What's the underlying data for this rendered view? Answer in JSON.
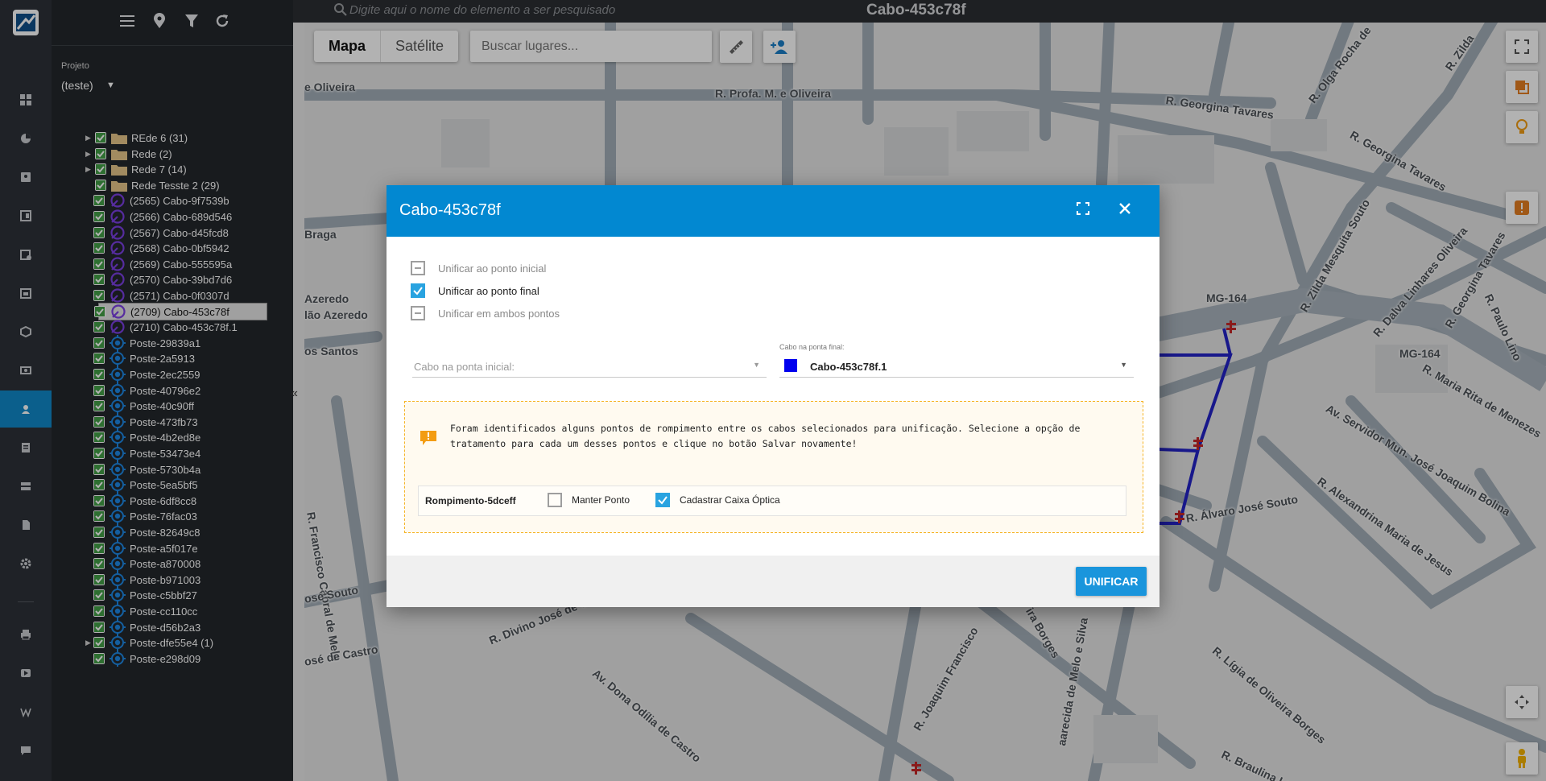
{
  "topbar": {
    "search_placeholder": "Digite aqui o nome do elemento a ser pesquisado",
    "title": "Cabo-453c78f"
  },
  "sidebar": {
    "project_label": "Projeto",
    "project_value": "(teste)",
    "tree_items": [
      {
        "label": "REde 6 (31)",
        "type": "folder",
        "expandable": true,
        "indent": 0
      },
      {
        "label": "Rede (2)",
        "type": "folder",
        "expandable": true,
        "indent": 0
      },
      {
        "label": "Rede 7 (14)",
        "type": "folder",
        "expandable": true,
        "indent": 0
      },
      {
        "label": "Rede Tesste 2 (29)",
        "type": "folder",
        "expandable": false,
        "indent": 0
      },
      {
        "label": "(2565) Cabo-9f7539b",
        "type": "cable",
        "indent": 1
      },
      {
        "label": "(2566) Cabo-689d546",
        "type": "cable",
        "indent": 1
      },
      {
        "label": "(2567) Cabo-d45fcd8",
        "type": "cable",
        "indent": 1
      },
      {
        "label": "(2568) Cabo-0bf5942",
        "type": "cable",
        "indent": 1
      },
      {
        "label": "(2569) Cabo-555595a",
        "type": "cable",
        "indent": 1
      },
      {
        "label": "(2570) Cabo-39bd7d6",
        "type": "cable",
        "indent": 1
      },
      {
        "label": "(2571) Cabo-0f0307d",
        "type": "cable",
        "indent": 1
      },
      {
        "label": "(2709) Cabo-453c78f",
        "type": "cable",
        "indent": 1,
        "selected": true
      },
      {
        "label": "(2710) Cabo-453c78f.1",
        "type": "cable",
        "indent": 1
      },
      {
        "label": "Poste-29839a1",
        "type": "pole",
        "indent": 1
      },
      {
        "label": "Poste-2a5913",
        "type": "pole",
        "indent": 1
      },
      {
        "label": "Poste-2ec2559",
        "type": "pole",
        "indent": 1
      },
      {
        "label": "Poste-40796e2",
        "type": "pole",
        "indent": 1
      },
      {
        "label": "Poste-40c90ff",
        "type": "pole",
        "indent": 1
      },
      {
        "label": "Poste-473fb73",
        "type": "pole",
        "indent": 1
      },
      {
        "label": "Poste-4b2ed8e",
        "type": "pole",
        "indent": 1
      },
      {
        "label": "Poste-53473e4",
        "type": "pole",
        "indent": 1
      },
      {
        "label": "Poste-5730b4a",
        "type": "pole",
        "indent": 1
      },
      {
        "label": "Poste-5ea5bf5",
        "type": "pole",
        "indent": 1
      },
      {
        "label": "Poste-6df8cc8",
        "type": "pole",
        "indent": 1
      },
      {
        "label": "Poste-76fac03",
        "type": "pole",
        "indent": 1
      },
      {
        "label": "Poste-82649c8",
        "type": "pole",
        "indent": 1
      },
      {
        "label": "Poste-a5f017e",
        "type": "pole",
        "indent": 1
      },
      {
        "label": "Poste-a870008",
        "type": "pole",
        "indent": 1
      },
      {
        "label": "Poste-b971003",
        "type": "pole",
        "indent": 1
      },
      {
        "label": "Poste-c5bbf27",
        "type": "pole",
        "indent": 1
      },
      {
        "label": "Poste-cc110cc",
        "type": "pole",
        "indent": 1
      },
      {
        "label": "Poste-d56b2a3",
        "type": "pole",
        "indent": 1
      },
      {
        "label": "Poste-dfe55e4 (1)",
        "type": "pole",
        "indent": 1,
        "expandable": true
      },
      {
        "label": "Poste-e298d09",
        "type": "pole",
        "indent": 1
      }
    ]
  },
  "map": {
    "type_buttons": [
      "Mapa",
      "Satélite"
    ],
    "places_placeholder": "Buscar lugares...",
    "streets": [
      "e Oliveira",
      "R. Profa. M. e Oliveira",
      "R. Georgina Tavares",
      "R. Olga Rocha de",
      "R. Georgina Tavares",
      "R. Zilda",
      "Oliveira",
      "Braga",
      "Azeredo",
      "lão Azeredo",
      "os Santos",
      "MG-164",
      "MG-164",
      "R. Zilda Mesquita Souto",
      "R. Dalva Linhares Oliveira",
      "R. Georgina Tavares",
      "R. Paulo Lino",
      "R. Maria Rita de Menezes",
      "Av. Servidor Mun. José Joaquim Bolina",
      "R. Alexandrina Maria de Jesus",
      "R. Álvaro José Souto",
      "R. Francisco Cabral de Melo",
      "osé Souto",
      "R. Divino José de Castro",
      "osé de Castro",
      "Av. Dona Odília de Castro",
      "R. Joaquim Francisco",
      "aarecida de Melo e Silva",
      "ira Borges",
      "R. Lígia de Oliveira Borges",
      "R. Braulina Lei"
    ]
  },
  "dialog": {
    "title": "Cabo-453c78f",
    "options": [
      {
        "label": "Unificar ao ponto inicial",
        "checked": false
      },
      {
        "label": "Unificar ao ponto final",
        "checked": true
      },
      {
        "label": "Unificar em ambos pontos",
        "checked": false
      }
    ],
    "start_cable_placeholder": "Cabo na ponta inicial:",
    "end_cable_label": "Cabo na ponta final:",
    "end_cable_value": "Cabo-453c78f.1",
    "end_cable_color": "#0000ee",
    "warning_text": "Foram identificados alguns pontos de rompimento entre os cabos selecionados para unificação. Selecione a opção de tratamento para cada um desses pontos e clique no botão Salvar novamente!",
    "rupture_name": "Rompimento-5dceff",
    "keep_point_label": "Manter Ponto",
    "keep_point_checked": false,
    "register_box_label": "Cadastrar Caixa Óptica",
    "register_box_checked": true,
    "unify_button": "UNIFICAR"
  },
  "colors": {
    "accent": "#0288d1",
    "rail_active": "#1088c9",
    "warning_border": "#f5b324",
    "cable_line": "#2323c8"
  }
}
